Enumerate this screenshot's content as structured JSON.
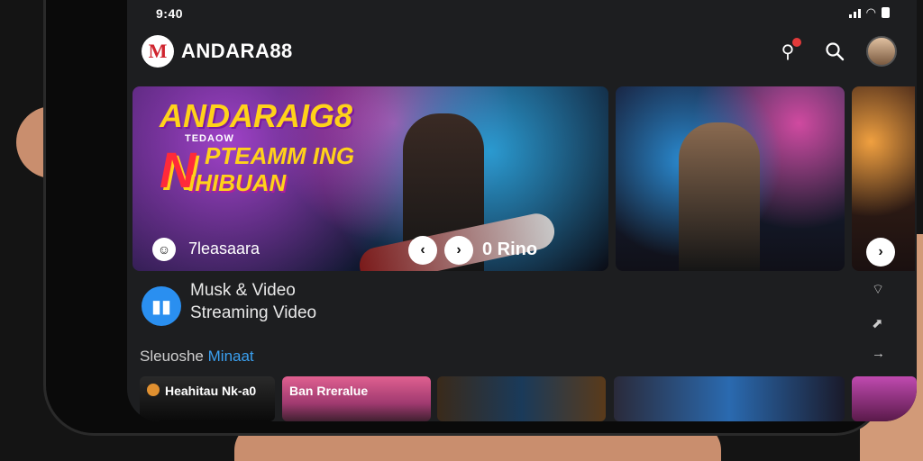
{
  "status": {
    "time": "9:40"
  },
  "header": {
    "brand": "ANDARA88",
    "logo_letter": "M"
  },
  "hero": {
    "title_top": "ANDARAIG8",
    "sub_small": "TEDAOW",
    "letter_n": "N",
    "title_mid": "PTEAMM ING",
    "title_bottom": "IHIBUAN",
    "channel_name": "7leasaara",
    "control_label": "0 Rino"
  },
  "info": {
    "title": "Musk & Video",
    "subtitle": "Streaming Video"
  },
  "section": {
    "label_a": "Sleuoshe",
    "label_b": "Minaat"
  },
  "thumbnails": [
    {
      "label": "Heahitau Nk-a0"
    },
    {
      "label": "Ban Rreralue"
    },
    {
      "label": ""
    },
    {
      "label": ""
    },
    {
      "label": ""
    }
  ],
  "colors": {
    "accent": "#2a8ff0",
    "brand_red": "#d0252f",
    "notif": "#e23a3a",
    "hero_yellow": "#ffd21a"
  }
}
